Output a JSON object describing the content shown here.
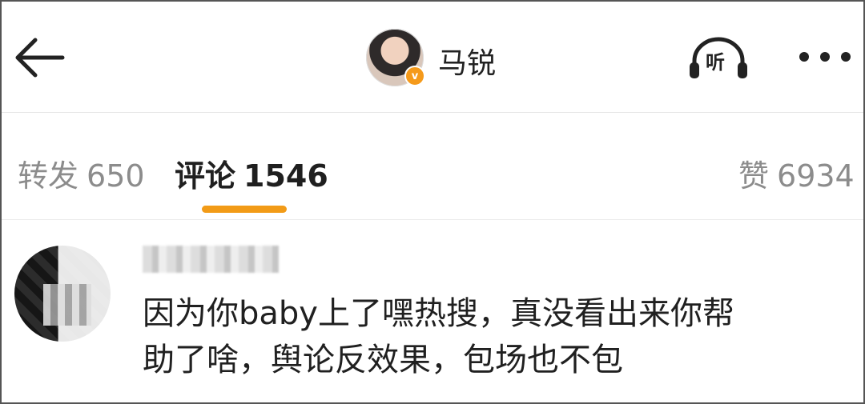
{
  "header": {
    "back_icon": "arrow-left-icon",
    "username": "马锐",
    "verified_icon": "verified-badge-icon",
    "listen_label": "听",
    "listen_icon": "headphones-icon",
    "more_icon": "more-horizontal-icon"
  },
  "tabs": [
    {
      "label": "转发",
      "count": "650"
    },
    {
      "label": "评论",
      "count": "1546"
    },
    {
      "label": "赞",
      "count": "6934"
    }
  ],
  "accent_color": "#f29b17",
  "comment": {
    "text_line1": "因为你baby上了嘿热搜，真没看出来你帮",
    "text_line2": "助了啥，舆论反效果，包场也不包"
  }
}
